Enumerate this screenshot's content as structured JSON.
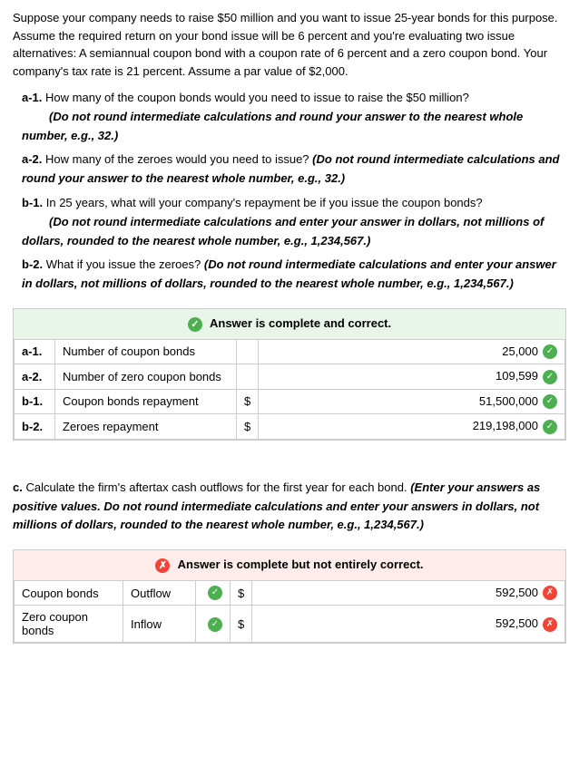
{
  "intro": {
    "text": "Suppose your company needs to raise $50 million and you want to issue 25-year bonds for this purpose. Assume the required return on your bond issue will be 6 percent and you're evaluating two issue alternatives: A semiannual coupon bond with a coupon rate of 6 percent and a zero coupon bond. Your company's tax rate is 21 percent. Assume a par value of $2,000."
  },
  "questions": {
    "a1_label": "a-1.",
    "a1_text": "How many of the coupon bonds would you need to issue to raise the $50 million?",
    "a1_bold": "(Do not round intermediate calculations and round your answer to the nearest whole number, e.g., 32.)",
    "a2_label": "a-2.",
    "a2_text": "How many of the zeroes would you need to issue?",
    "a2_bold": "(Do not round intermediate calculations and round your answer to the nearest whole number, e.g., 32.)",
    "b1_label": "b-1.",
    "b1_text": "In 25 years, what will your company's repayment be if you issue the coupon bonds?",
    "b1_bold": "(Do not round intermediate calculations and enter your answer in dollars, not millions of dollars, rounded to the nearest whole number, e.g., 1,234,567.)",
    "b2_label": "b-2.",
    "b2_text": "What if you issue the zeroes?",
    "b2_bold": "(Do not round intermediate calculations and enter your answer in dollars, not millions of dollars, rounded to the nearest whole number, e.g., 1,234,567.)"
  },
  "answer_box_1": {
    "header": "Answer is complete and correct.",
    "rows": [
      {
        "label": "a-1.",
        "desc": "Number of coupon bonds",
        "dollar": "",
        "value": "25,000",
        "status": "check"
      },
      {
        "label": "a-2.",
        "desc": "Number of zero coupon bonds",
        "dollar": "",
        "value": "109,599",
        "status": "check"
      },
      {
        "label": "b-1.",
        "desc": "Coupon bonds repayment",
        "dollar": "$",
        "value": "51,500,000",
        "status": "check"
      },
      {
        "label": "b-2.",
        "desc": "Zeroes repayment",
        "dollar": "$",
        "value": "219,198,000",
        "status": "check"
      }
    ]
  },
  "section_c": {
    "label": "c.",
    "text": "Calculate the firm's aftertax cash outflows for the first year for each bond.",
    "bold": "(Enter your answers as positive values. Do not round intermediate calculations and enter your answers in dollars, not millions of dollars, rounded to the nearest whole number, e.g., 1,234,567.)"
  },
  "answer_box_2": {
    "header": "Answer is complete but not entirely correct.",
    "rows": [
      {
        "label": "Coupon bonds",
        "desc": "Outflow",
        "dollar": "$",
        "value": "592,500",
        "check_status": "check",
        "value_status": "x"
      },
      {
        "label": "Zero coupon bonds",
        "desc": "Inflow",
        "dollar": "$",
        "value": "592,500",
        "check_status": "check",
        "value_status": "x"
      }
    ]
  }
}
